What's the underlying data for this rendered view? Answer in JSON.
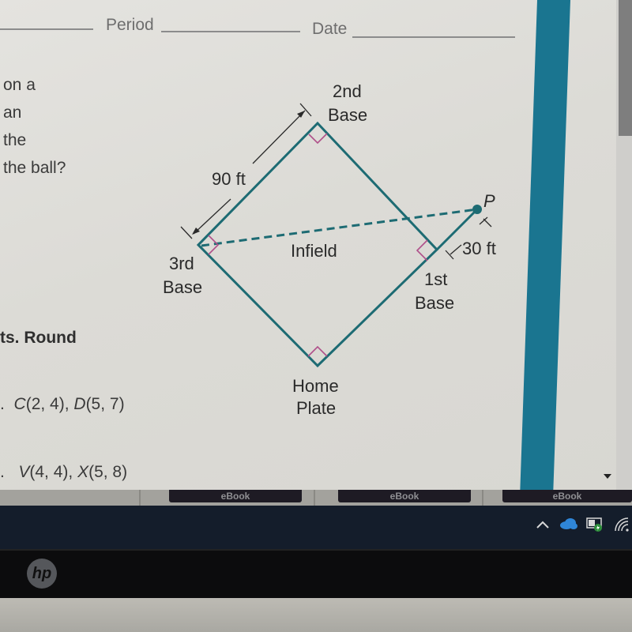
{
  "worksheet": {
    "header": {
      "period_label": "Period",
      "date_label": "Date"
    },
    "problem_text_lines": [
      "on a",
      "an",
      "the",
      "the ball?"
    ],
    "instructions_fragment": "ts. Round",
    "exercises": [
      {
        "bullet": ".",
        "p1_name": "C",
        "p1_coords": "(2, 4), ",
        "p2_name": "D",
        "p2_coords": "(5, 7)"
      },
      {
        "bullet": ".",
        "p1_name": "V",
        "p1_coords": "(4, 4), ",
        "p2_name": "X",
        "p2_coords": "(5, 8)"
      }
    ]
  },
  "diagram": {
    "labels": {
      "second_base_line1": "2nd",
      "second_base_line2": "Base",
      "third_base_line1": "3rd",
      "third_base_line2": "Base",
      "first_base_line1": "1st",
      "first_base_line2": "Base",
      "home_plate_line1": "Home",
      "home_plate_line2": "Plate",
      "infield": "Infield",
      "point": "P",
      "side_length": "90 ft",
      "extension_length": "30 ft"
    },
    "colors": {
      "field_line": "#1d6b73",
      "right_angle_marker": "#b0508a",
      "dimension_line": "#2a2a2a"
    }
  },
  "bottom_tabs": [
    {
      "label": "eBook"
    },
    {
      "label": "eBook"
    },
    {
      "label": "eBook"
    }
  ],
  "taskbar": {
    "tray_icons": [
      "chevron-up-icon",
      "onedrive-cloud-icon",
      "battery-power-icon",
      "wifi-icon"
    ]
  },
  "laptop": {
    "brand_logo": "hp"
  },
  "colors": {
    "accent_bar": "#1a7590",
    "taskbar_bg": "#141d2b",
    "tab_bg": "#1e1b24"
  }
}
